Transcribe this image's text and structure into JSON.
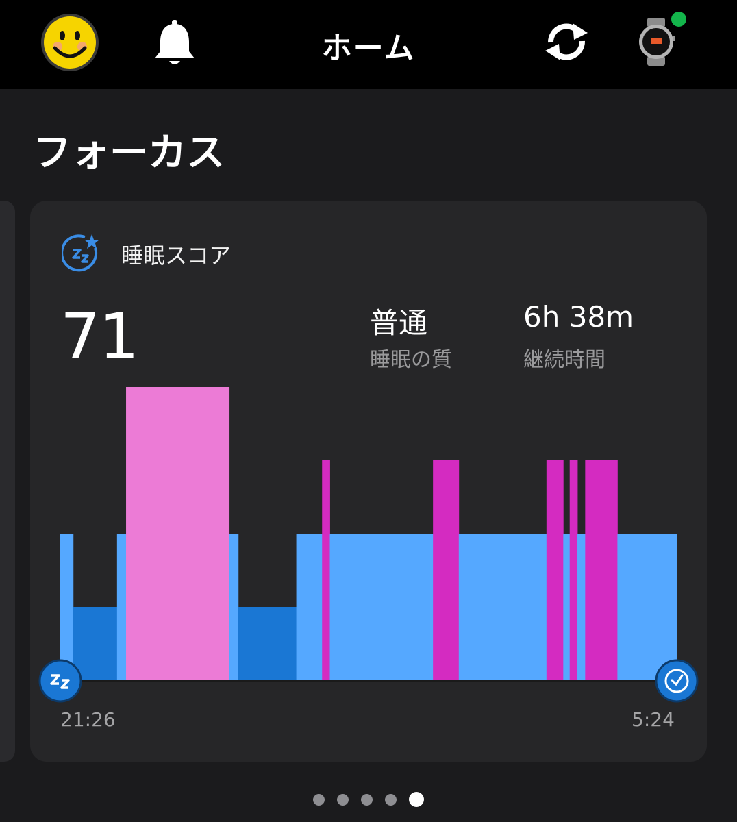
{
  "header": {
    "title": "ホーム",
    "avatar_icon": "smiley-face-avatar",
    "notifications_icon": "bell-icon",
    "sync_icon": "sync-icon",
    "device_icon": "watch-icon",
    "device_status_color": "#13b54b"
  },
  "section": {
    "title": "フォーカス"
  },
  "card": {
    "icon": "sleep-score-icon",
    "title": "睡眠スコア",
    "score": "71",
    "quality": {
      "value": "普通",
      "label": "睡眠の質"
    },
    "duration": {
      "value": "6h 38m",
      "label": "継続時間"
    },
    "start_time": "21:26",
    "end_time": "5:24",
    "start_icon": "sleep-zz-icon",
    "end_icon": "clock-icon"
  },
  "chart_data": {
    "type": "bar",
    "x_range": [
      "21:26",
      "5:24"
    ],
    "stages": [
      "deep",
      "light",
      "rem",
      "awake"
    ],
    "stage_colors": {
      "deep": "#1a77d4",
      "light": "#55a8ff",
      "rem": "#ec7bd6",
      "awake": "#d42bc1"
    },
    "segments": [
      {
        "stage": "light",
        "duration_min": 10
      },
      {
        "stage": "deep",
        "duration_min": 34
      },
      {
        "stage": "light",
        "duration_min": 7
      },
      {
        "stage": "rem",
        "duration_min": 80
      },
      {
        "stage": "light",
        "duration_min": 7
      },
      {
        "stage": "deep",
        "duration_min": 45
      },
      {
        "stage": "light",
        "duration_min": 20
      },
      {
        "stage": "awake",
        "duration_min": 6
      },
      {
        "stage": "light",
        "duration_min": 80
      },
      {
        "stage": "awake",
        "duration_min": 20
      },
      {
        "stage": "light",
        "duration_min": 68
      },
      {
        "stage": "awake",
        "duration_min": 13
      },
      {
        "stage": "light",
        "duration_min": 5
      },
      {
        "stage": "awake",
        "duration_min": 6
      },
      {
        "stage": "light",
        "duration_min": 6
      },
      {
        "stage": "awake",
        "duration_min": 25
      },
      {
        "stage": "light",
        "duration_min": 46
      }
    ]
  },
  "pagination": {
    "count": 5,
    "active": 4
  }
}
